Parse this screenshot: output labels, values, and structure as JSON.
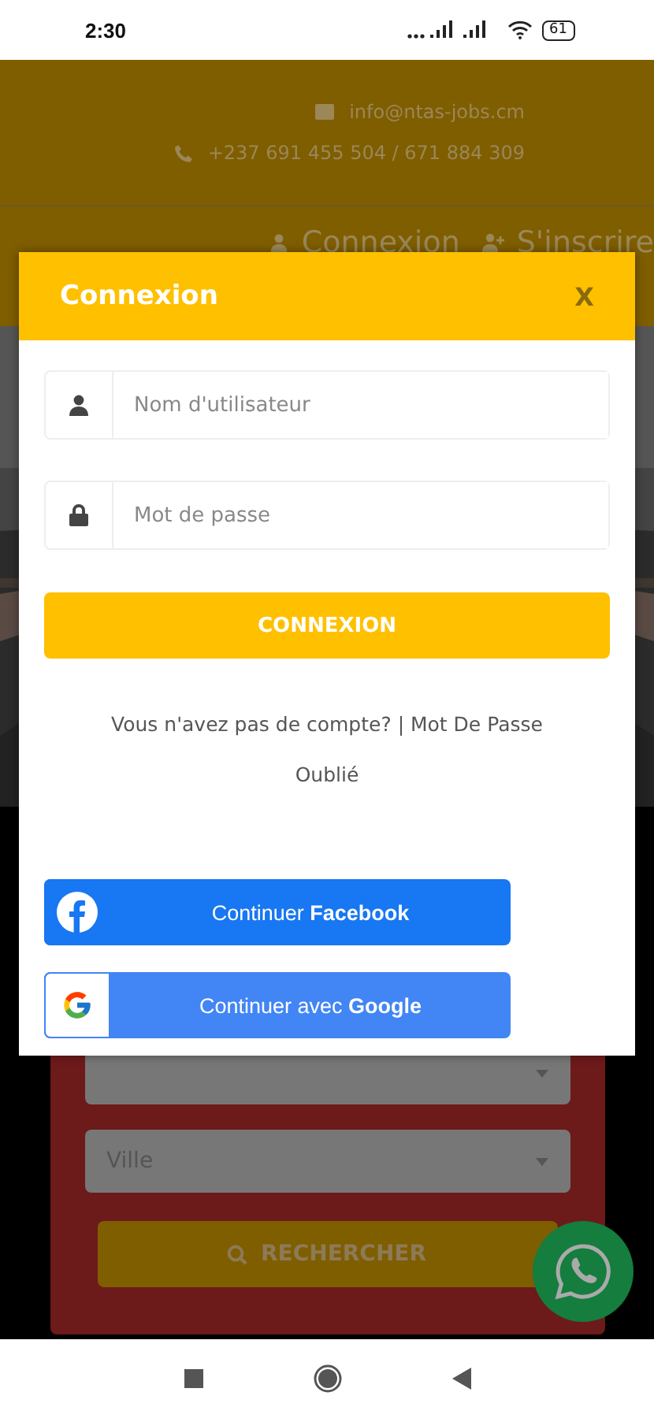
{
  "status_bar": {
    "time": "2:30",
    "battery": "61"
  },
  "header": {
    "email": "info@ntas-jobs.cm",
    "phone": "+237 691 455 504 / 671 884 309",
    "nav": [
      {
        "kind": "login",
        "label": "Connexion"
      },
      {
        "kind": "signup",
        "label": "S'inscrire"
      }
    ]
  },
  "search_card": {
    "fields": [
      {
        "kind": "select"
      },
      {
        "kind": "select",
        "placeholder": "Ville"
      }
    ],
    "button": "RECHERCHER"
  },
  "modal": {
    "title": "Connexion",
    "close": "X",
    "fields": [
      {
        "kind": "user",
        "placeholder": "Nom d'utilisateur"
      },
      {
        "kind": "password",
        "placeholder": "Mot de passe"
      }
    ],
    "submit": "CONNEXION",
    "footer": "Vous n'avez pas de compte? | Mot De Passe Oublié",
    "social": [
      {
        "kind": "facebook",
        "label": "Continuer **Facebook**"
      },
      {
        "kind": "google",
        "label": "Continuer avec **Google**"
      }
    ]
  }
}
